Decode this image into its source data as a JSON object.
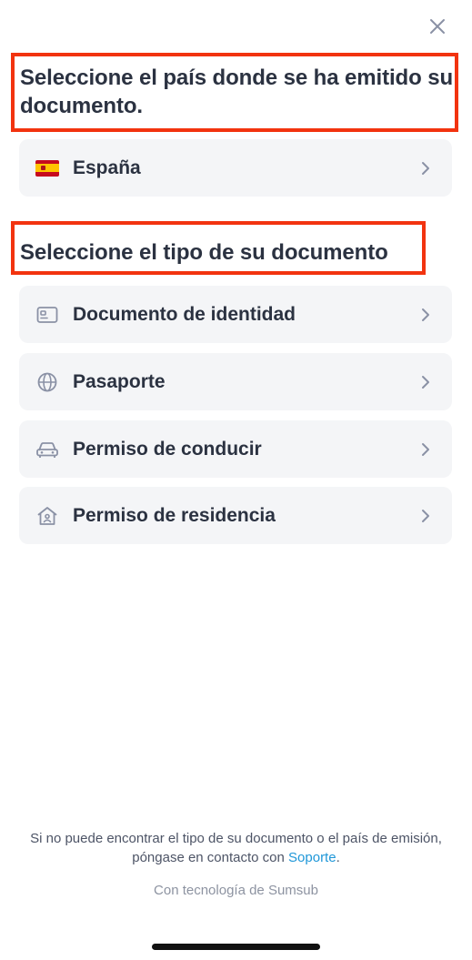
{
  "header": {
    "close_icon": "close-icon"
  },
  "country_section": {
    "title": "Seleccione el país donde se ha emitido su documento.",
    "selected_country": {
      "label": "España",
      "icon": "spain-flag-icon"
    }
  },
  "document_section": {
    "title": "Seleccione el tipo de su documento",
    "items": [
      {
        "label": "Documento de identidad",
        "icon": "id-card-icon"
      },
      {
        "label": "Pasaporte",
        "icon": "globe-icon"
      },
      {
        "label": "Permiso de conducir",
        "icon": "car-icon"
      },
      {
        "label": "Permiso de residencia",
        "icon": "home-icon"
      }
    ]
  },
  "footer": {
    "help_text_before": "Si no puede encontrar el tipo de su documento o el país de emisión, póngase en contacto con ",
    "support_link": "Soporte",
    "help_text_after": ".",
    "powered_by": "Con tecnología de Sumsub"
  },
  "colors": {
    "highlight_border": "#f2330f",
    "card_background": "#f4f5f7",
    "text_primary": "#2b3241",
    "link": "#1f97d8",
    "icon": "#8a91a5"
  }
}
